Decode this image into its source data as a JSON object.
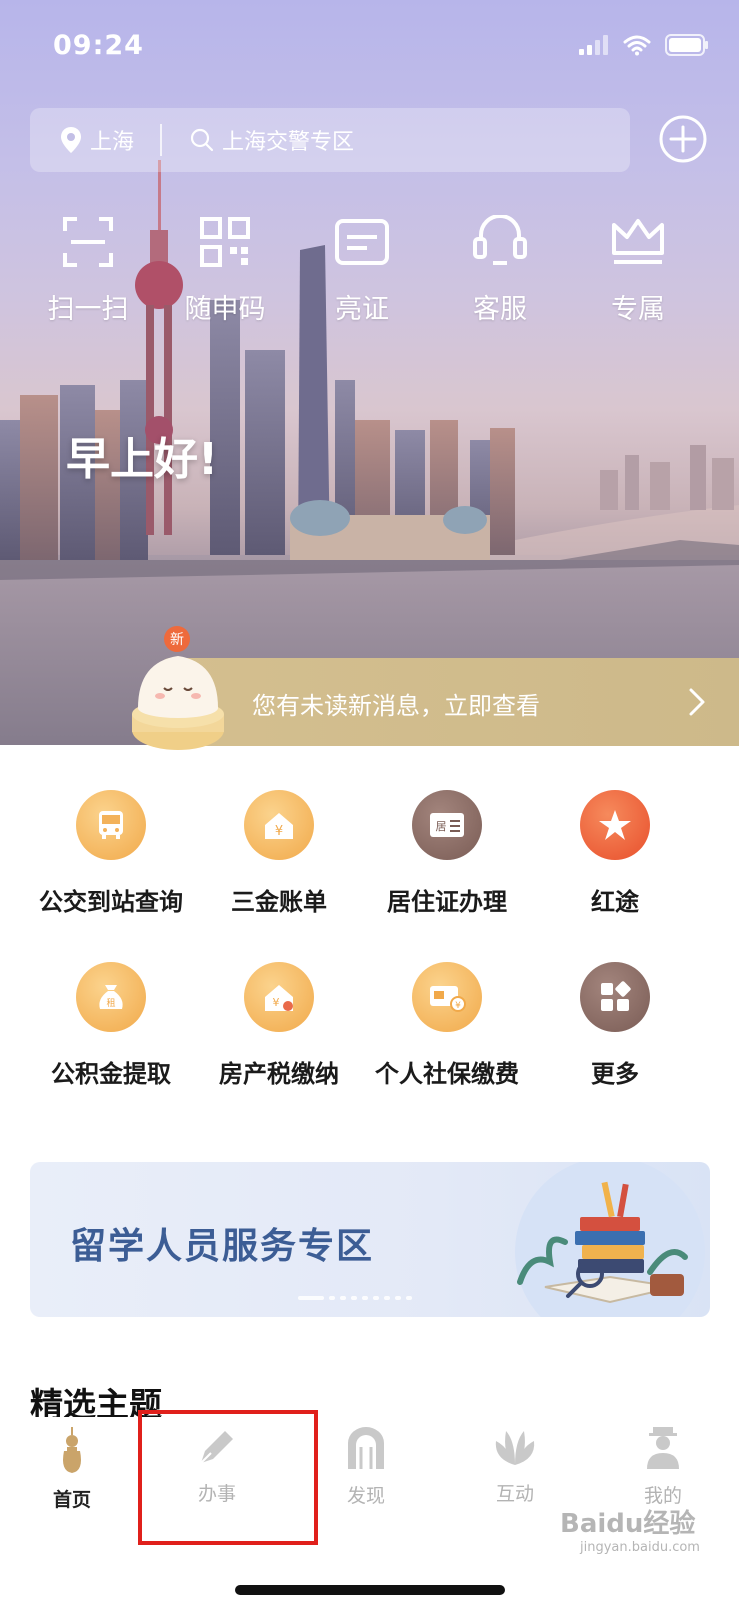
{
  "status_bar": {
    "time": "09:24"
  },
  "search": {
    "location": "上海",
    "placeholder": "上海交警专区"
  },
  "quick_actions": [
    {
      "label": "扫一扫",
      "icon": "scan-icon"
    },
    {
      "label": "随申码",
      "icon": "qr-code-icon"
    },
    {
      "label": "亮证",
      "icon": "id-card-icon"
    },
    {
      "label": "客服",
      "icon": "headset-icon"
    },
    {
      "label": "专属",
      "icon": "crown-icon"
    }
  ],
  "greeting": "早上好!",
  "notification": {
    "badge": "新",
    "text": "您有未读新消息，立即查看"
  },
  "services": [
    {
      "label": "公交到站查询",
      "icon": "bus-icon",
      "color": "#f3b25a"
    },
    {
      "label": "三金账单",
      "icon": "house-yuan-icon",
      "color": "#f3b25a"
    },
    {
      "label": "居住证办理",
      "icon": "residence-card-icon",
      "color": "#8a6b63"
    },
    {
      "label": "红途",
      "icon": "red-star-icon",
      "color": "#ec5a35"
    },
    {
      "label": "公积金提取",
      "icon": "money-bag-icon",
      "color": "#f3b25a"
    },
    {
      "label": "房产税缴纳",
      "icon": "property-tax-icon",
      "color": "#f3b25a"
    },
    {
      "label": "个人社保缴费",
      "icon": "social-security-icon",
      "color": "#f3b25a"
    },
    {
      "label": "更多",
      "icon": "more-grid-icon",
      "color": "#8a6b63"
    }
  ],
  "banner": {
    "title": "留学人员服务专区"
  },
  "section": {
    "title": "精选主题"
  },
  "tabs": [
    {
      "label": "首页",
      "icon": "gourd-home-icon",
      "active": true
    },
    {
      "label": "办事",
      "icon": "pen-icon",
      "active": false
    },
    {
      "label": "发现",
      "icon": "arch-icon",
      "active": false
    },
    {
      "label": "互动",
      "icon": "magnolia-icon",
      "active": false
    },
    {
      "label": "我的",
      "icon": "person-icon",
      "active": false
    }
  ],
  "watermark": {
    "text": "Baidu经验",
    "sub": "jingyan.baidu.com"
  }
}
